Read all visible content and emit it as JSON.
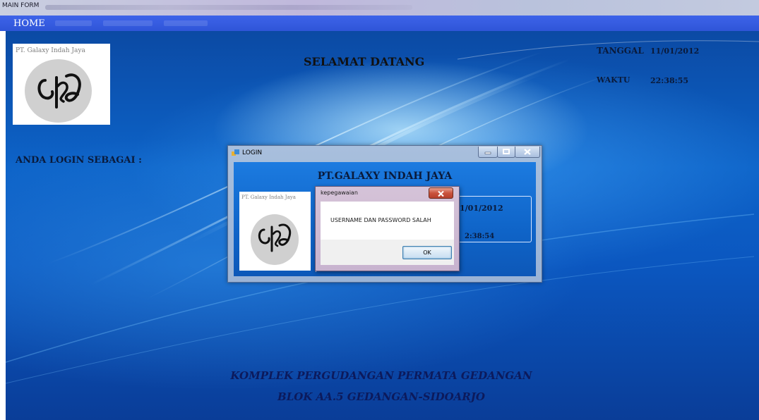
{
  "window": {
    "title": "MAIN FORM"
  },
  "menu": {
    "items": [
      {
        "label": "HOME",
        "state": "active"
      },
      {
        "label": "",
        "state": "dimmed"
      },
      {
        "label": "",
        "state": "dimmed"
      },
      {
        "label": "",
        "state": "dimmed"
      }
    ]
  },
  "logo": {
    "caption": "PT. Galaxy Indah Jaya",
    "icon": "cia-logo-icon"
  },
  "main": {
    "welcome": "SELAMAT DATANG",
    "login_as_label": "ANDA LOGIN SEBAGAI :",
    "date_label": "TANGGAL",
    "date_value": "11/01/2012",
    "time_label": "WAKTU",
    "time_value": "22:38:55",
    "address_line1": "KOMPLEK PERGUDANGAN PERMATA GEDANGAN",
    "address_line2": "BLOK AA.5 GEDANGAN-SIDOARJO"
  },
  "login_window": {
    "title": "LOGIN",
    "heading": "PT.GALAXY INDAH JAYA",
    "logo_caption": "PT. Galaxy Indah Jaya",
    "date_partial": "1/01/2012",
    "time_partial": "2:38:54",
    "icons": [
      "minimize-icon",
      "maximize-icon",
      "close-icon"
    ]
  },
  "message_box": {
    "title": "kepegawaian",
    "text": "USERNAME DAN PASSWORD SALAH",
    "ok_label": "OK"
  },
  "colors": {
    "menu_bar": "#3d63e9",
    "background": "#0d63c8",
    "close_button": "#c9523c"
  }
}
